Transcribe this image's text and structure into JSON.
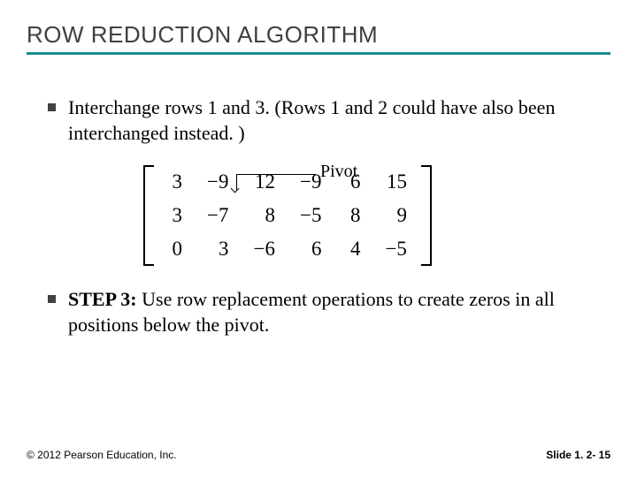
{
  "title": "ROW REDUCTION ALGORITHM",
  "bullets": {
    "b1": "Interchange rows 1 and 3. (Rows 1 and 2 could have also been interchanged instead. )",
    "b2_step": "STEP 3:",
    "b2_rest": " Use row replacement operations to create zeros in all positions below the pivot."
  },
  "pivot_label": "Pivot",
  "matrix": {
    "r0": {
      "c0": "3",
      "c1": "−9",
      "c2": "12",
      "c3": "−9",
      "c4": "6",
      "c5": "15"
    },
    "r1": {
      "c0": "3",
      "c1": "−7",
      "c2": "8",
      "c3": "−5",
      "c4": "8",
      "c5": "9"
    },
    "r2": {
      "c0": "0",
      "c1": "3",
      "c2": "−6",
      "c3": "6",
      "c4": "4",
      "c5": "−5"
    }
  },
  "footer": {
    "copyright": "© 2012 Pearson Education, Inc.",
    "slide": "Slide 1. 2- 15"
  }
}
